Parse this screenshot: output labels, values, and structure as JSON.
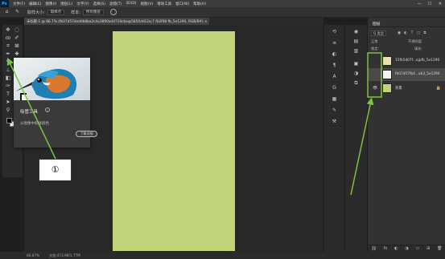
{
  "app": {
    "logo": "Ps"
  },
  "menubar": {
    "items": [
      "文件(F)",
      "编辑(E)",
      "图像(I)",
      "图层(L)",
      "文字(Y)",
      "选择(S)",
      "滤镜(T)",
      "3D(D)",
      "视图(V)",
      "增效工具",
      "窗口(W)",
      "帮助(H)"
    ],
    "window_buttons": [
      "—",
      "☐",
      "✕"
    ]
  },
  "options": {
    "sample_size_label": "取样大小:",
    "sample_size_value": "取样点",
    "sample_label": "样本:",
    "sample_value": "所有图层"
  },
  "document": {
    "tab_title": "未标题-1 @ 66.7% (fb07d57deddb8ba2cda3890ad4719cbe@5850dd12a;7 fb2f08 fb_5e1290, RGB/8#) ×",
    "canvas_color": "#c2d47a"
  },
  "tooltip": {
    "title": "吸管工具",
    "info": "i",
    "description": "从图像中取样颜色",
    "button": "了解详细"
  },
  "callout": {
    "label": "①"
  },
  "layers": {
    "title": "图层",
    "filter_value": "Q 类型",
    "blend_label": "正常",
    "opacity_label": "不透明度:",
    "lock_label": "锁定:",
    "fill_label": "填充:",
    "rows": [
      {
        "name": "15fb5d07f...ajpfb_5e1290",
        "eye": "",
        "lock": "",
        "thumb": "#e9e0b0"
      },
      {
        "name": "fb07d57fb4...ab3_5e1290",
        "eye": "",
        "lock": "",
        "thumb": "#f4f4f4"
      },
      {
        "name": "背景",
        "eye": "👁",
        "lock": "🔒",
        "thumb": "#c2d47a"
      }
    ],
    "footer_icons": [
      "⛓",
      "fx",
      "◐",
      "◑",
      "▭",
      "⊞",
      "🗑"
    ]
  },
  "status": {
    "zoom": "66.67%",
    "doc_info": "文档:473.9K/1.77M"
  },
  "colors": {
    "accent_green": "#7cc242",
    "canvas_green": "#c2d47a"
  }
}
